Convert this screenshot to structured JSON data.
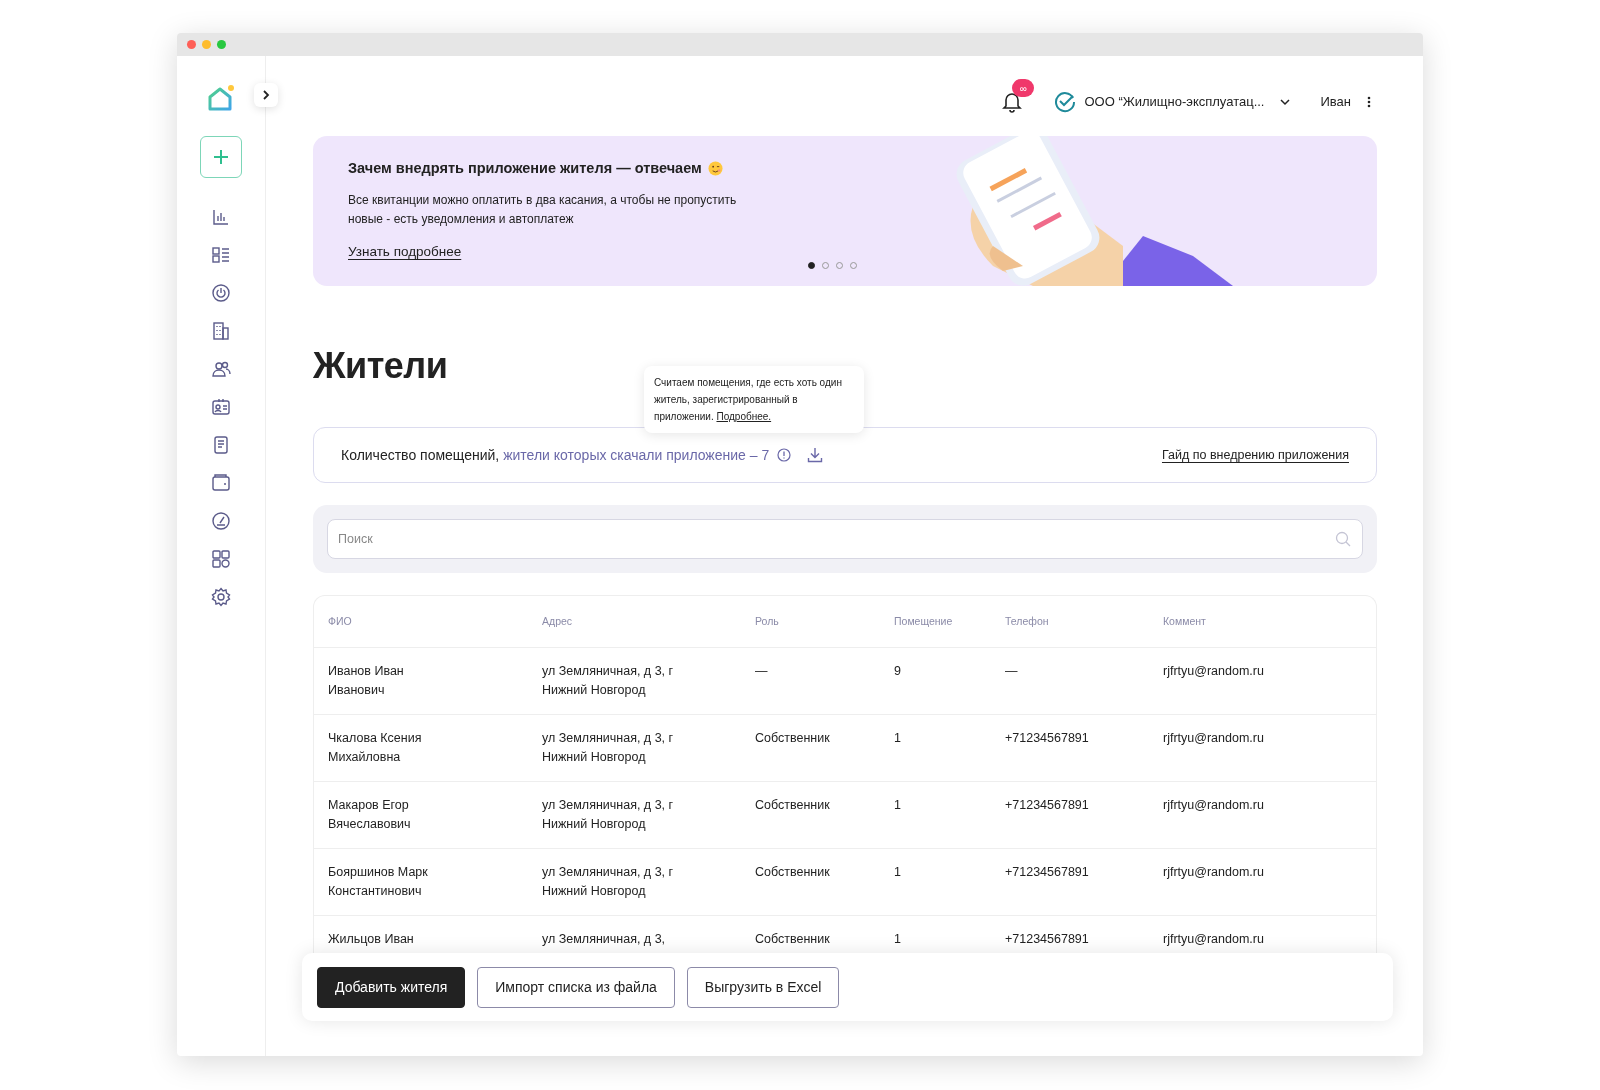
{
  "sidebar": {
    "items": [
      {
        "kind": "chart"
      },
      {
        "kind": "list"
      },
      {
        "kind": "power"
      },
      {
        "kind": "building"
      },
      {
        "kind": "people"
      },
      {
        "kind": "badge"
      },
      {
        "kind": "document"
      },
      {
        "kind": "wallet"
      },
      {
        "kind": "gauge"
      },
      {
        "kind": "grid"
      },
      {
        "kind": "settings"
      }
    ]
  },
  "header": {
    "notifications_badge": "∞",
    "organization": "ООО “Жилищно-эксплуатац...",
    "user": "Иван"
  },
  "banner": {
    "title": "Зачем внедрять приложение жителя — отвечаем",
    "text": "Все квитанции можно оплатить в два касания, а чтобы не пропустить новые - есть уведомления и автоплатеж",
    "link": "Узнать подробнее",
    "slides": [
      {
        "selected": true
      },
      {
        "selected": false
      },
      {
        "selected": false
      },
      {
        "selected": false
      }
    ],
    "kind": "picture"
  },
  "page_title": "Жители",
  "info": {
    "label": "Количество помещений,",
    "highlight": "жители которых скачали приложение",
    "count": "– 7",
    "guide_link": "Гайд по внедрению приложения"
  },
  "tooltip": {
    "text": "Считаем помещения, где есть хоть один житель, зарегистрированный в приложении.",
    "link": "Подробнее."
  },
  "search": {
    "placeholder": "Поиск"
  },
  "table": {
    "columns": [
      "ФИО",
      "Адрес",
      "Роль",
      "Помещение",
      "Телефон",
      "Коммент"
    ],
    "rows": [
      {
        "name": "Иванов Иван Иванович",
        "address": "ул Земляничная, д 3, г Нижний Новгород",
        "role": "—",
        "room": "9",
        "phone": "—",
        "comment": "rjfrtyu@random.ru"
      },
      {
        "name": "Чкалова Ксения Михайловна",
        "address": "ул Земляничная, д 3, г Нижний Новгород",
        "role": "Собственник",
        "room": "1",
        "phone": "+71234567891",
        "comment": "rjfrtyu@random.ru"
      },
      {
        "name": "Макаров Егор Вячеславович",
        "address": "ул Земляничная, д 3, г Нижний Новгород",
        "role": "Собственник",
        "room": "1",
        "phone": "+71234567891",
        "comment": "rjfrtyu@random.ru"
      },
      {
        "name": "Бояршинов Марк Константинович",
        "address": "ул Земляничная, д 3, г Нижний Новгород",
        "role": "Собственник",
        "room": "1",
        "phone": "+71234567891",
        "comment": "rjfrtyu@random.ru"
      },
      {
        "name": "Жильцов Иван",
        "address": "ул Земляничная, д 3,",
        "role": "Собственник",
        "room": "1",
        "phone": "+71234567891",
        "comment": "rjfrtyu@random.ru"
      }
    ]
  },
  "actions": [
    {
      "label": "Добавить жителя",
      "kind": "primary"
    },
    {
      "label": "Импорт списка из файла",
      "kind": "outline"
    },
    {
      "label": "Выгрузить в Excel",
      "kind": "outline"
    }
  ]
}
